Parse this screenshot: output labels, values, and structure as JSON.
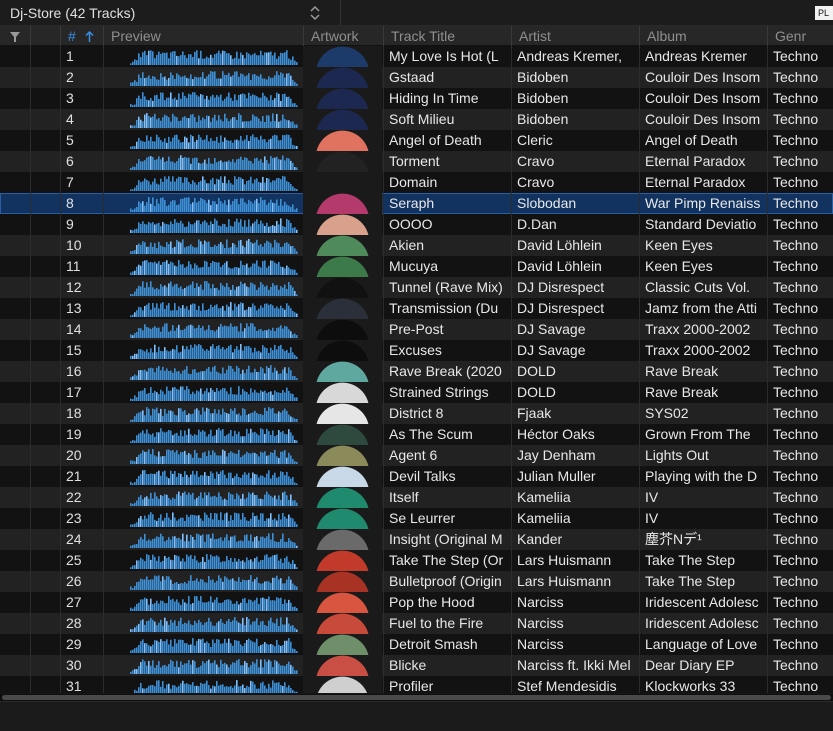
{
  "playlist": {
    "title": "Dj-Store (42 Tracks)",
    "corner_button": "PL"
  },
  "columns": {
    "number": "#",
    "preview": "Preview",
    "artwork": "Artwork",
    "track_title": "Track Title",
    "artist": "Artist",
    "album": "Album",
    "genre": "Genr"
  },
  "colors": {
    "accent": "#3a8ee6",
    "selected_row": "#123360",
    "waveform": "#3d8fd6"
  },
  "selected_track": 8,
  "tracks": [
    {
      "n": "1",
      "title": "My Love Is Hot (L",
      "artist": "Andreas Kremer,",
      "album": "Andreas Kremer",
      "genre": "Techno",
      "art": "#1c3b6b"
    },
    {
      "n": "2",
      "title": "Gstaad",
      "artist": "Bidoben",
      "album": "Couloir Des Insom",
      "genre": "Techno",
      "art": "#1c2850"
    },
    {
      "n": "3",
      "title": "Hiding In Time",
      "artist": "Bidoben",
      "album": "Couloir Des Insom",
      "genre": "Techno",
      "art": "#1c2850"
    },
    {
      "n": "4",
      "title": "Soft Milieu",
      "artist": "Bidoben",
      "album": "Couloir Des Insom",
      "genre": "Techno",
      "art": "#1c2850"
    },
    {
      "n": "5",
      "title": "Angel of Death",
      "artist": "Cleric",
      "album": "Angel of Death",
      "genre": "Techno",
      "art": "#e0735f"
    },
    {
      "n": "6",
      "title": "Torment",
      "artist": "Cravo",
      "album": "Eternal Paradox",
      "genre": "Techno",
      "art": "#222222"
    },
    {
      "n": "7",
      "title": "Domain",
      "artist": "Cravo",
      "album": "Eternal Paradox",
      "genre": "Techno",
      "art": "#1a1a1a"
    },
    {
      "n": "8",
      "title": "Seraph",
      "artist": "Slobodan",
      "album": "War Pimp Renaiss",
      "genre": "Techno",
      "art": "#b33a6a"
    },
    {
      "n": "9",
      "title": "OOOO",
      "artist": "D.Dan",
      "album": "Standard Deviatio",
      "genre": "Techno",
      "art": "#d9a08c"
    },
    {
      "n": "10",
      "title": "Akien",
      "artist": "David Löhlein",
      "album": "Keen Eyes",
      "genre": "Techno",
      "art": "#4e8a5a"
    },
    {
      "n": "11",
      "title": "Mucuya",
      "artist": "David Löhlein",
      "album": "Keen Eyes",
      "genre": "Techno",
      "art": "#3d7a4a"
    },
    {
      "n": "12",
      "title": "Tunnel (Rave Mix)",
      "artist": "DJ Disrespect",
      "album": "Classic Cuts Vol.",
      "genre": "Techno",
      "art": "#111111"
    },
    {
      "n": "13",
      "title": "Transmission (Du",
      "artist": "DJ Disrespect",
      "album": "Jamz from the Atti",
      "genre": "Techno",
      "art": "#2a2f3a"
    },
    {
      "n": "14",
      "title": "Pre-Post",
      "artist": "DJ Savage",
      "album": "Traxx 2000-2002",
      "genre": "Techno",
      "art": "#0d0d0d"
    },
    {
      "n": "15",
      "title": "Excuses",
      "artist": "DJ Savage",
      "album": "Traxx 2000-2002",
      "genre": "Techno",
      "art": "#0d0d0d"
    },
    {
      "n": "16",
      "title": "Rave Break (2020",
      "artist": "DOLD",
      "album": "Rave Break",
      "genre": "Techno",
      "art": "#5fa8a0"
    },
    {
      "n": "17",
      "title": "Strained Strings",
      "artist": "DOLD",
      "album": "Rave Break",
      "genre": "Techno",
      "art": "#d8d8d8"
    },
    {
      "n": "18",
      "title": "District 8",
      "artist": "Fjaak",
      "album": "SYS02",
      "genre": "Techno",
      "art": "#e6e6e6"
    },
    {
      "n": "19",
      "title": "As The Scum",
      "artist": "Héctor Oaks",
      "album": "Grown From The",
      "genre": "Techno",
      "art": "#2e4a3e"
    },
    {
      "n": "20",
      "title": "Agent 6",
      "artist": "Jay Denham",
      "album": "Lights Out",
      "genre": "Techno",
      "art": "#8a8a5a"
    },
    {
      "n": "21",
      "title": "Devil Talks",
      "artist": "Julian Muller",
      "album": "Playing with the D",
      "genre": "Techno",
      "art": "#c9d8e6"
    },
    {
      "n": "22",
      "title": "Itself",
      "artist": "Kameliia",
      "album": "IV",
      "genre": "Techno",
      "art": "#1f8a6e"
    },
    {
      "n": "23",
      "title": "Se Leurrer",
      "artist": "Kameliia",
      "album": "IV",
      "genre": "Techno",
      "art": "#1f8a6e"
    },
    {
      "n": "24",
      "title": "Insight (Original M",
      "artist": "Kander",
      "album": "塵芥Nデ¹",
      "genre": "Techno",
      "art": "#6a6a6a"
    },
    {
      "n": "25",
      "title": "Take The Step (Or",
      "artist": "Lars Huismann",
      "album": "Take The Step",
      "genre": "Techno",
      "art": "#c23b2a"
    },
    {
      "n": "26",
      "title": "Bulletproof (Origin",
      "artist": "Lars Huismann",
      "album": "Take The Step",
      "genre": "Techno",
      "art": "#a83224"
    },
    {
      "n": "27",
      "title": "Pop the Hood",
      "artist": "Narciss",
      "album": "Iridescent Adolesc",
      "genre": "Techno",
      "art": "#d8553f"
    },
    {
      "n": "28",
      "title": "Fuel to the Fire",
      "artist": "Narciss",
      "album": "Iridescent Adolesc",
      "genre": "Techno",
      "art": "#c84a3a"
    },
    {
      "n": "29",
      "title": "Detroit Smash",
      "artist": "Narciss",
      "album": "Language of Love",
      "genre": "Techno",
      "art": "#6f8f6a"
    },
    {
      "n": "30",
      "title": "Blicke",
      "artist": "Narciss ft. Ikki Mel",
      "album": "Dear Diary EP",
      "genre": "Techno",
      "art": "#c94f45"
    },
    {
      "n": "31",
      "title": "Profiler",
      "artist": "Stef Mendesidis",
      "album": "Klockworks 33",
      "genre": "Techno",
      "art": "#cfcfcf"
    }
  ]
}
